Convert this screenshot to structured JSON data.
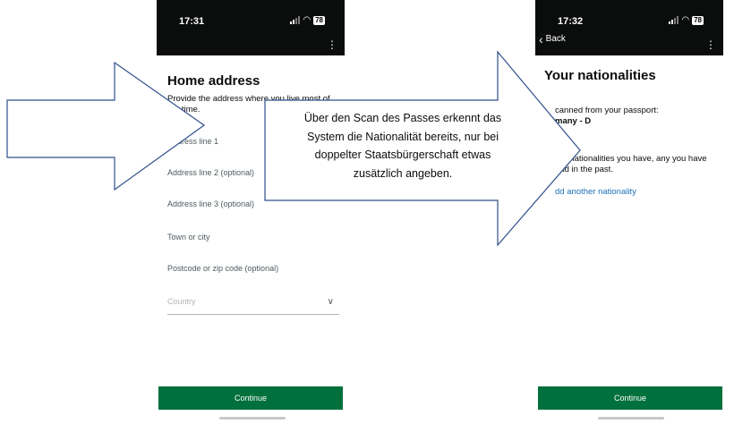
{
  "left_screen": {
    "status": {
      "time": "17:31",
      "battery": "78"
    },
    "title": "Home address",
    "intro": "Provide the address where you live most of the time.",
    "fields": [
      "Address line 1",
      "Address line 2 (optional)",
      "Address line 3 (optional)",
      "Town or city",
      "Postcode or zip code (optional)"
    ],
    "country_placeholder": "Country",
    "continue_label": "Continue"
  },
  "right_screen": {
    "status": {
      "time": "17:32",
      "battery": "78"
    },
    "back_label": "Back",
    "title": "Your nationalities",
    "scanned_label": "canned from your passport:",
    "scanned_value": "many - D",
    "other_text": "ner nationalities you have, any you have had in the past.",
    "add_link": "dd another nationality",
    "continue_label": "Continue"
  },
  "annotation": {
    "lines": [
      "Über den Scan des Passes erkennt das",
      "System die Nationalität bereits, nur bei",
      "doppelter Staatsbürgerschaft etwas",
      "zusätzlich angeben."
    ]
  },
  "colors": {
    "continue_green": "#00703c",
    "link_blue": "#1d70b8",
    "arrow_stroke": "#2f4f8a"
  }
}
